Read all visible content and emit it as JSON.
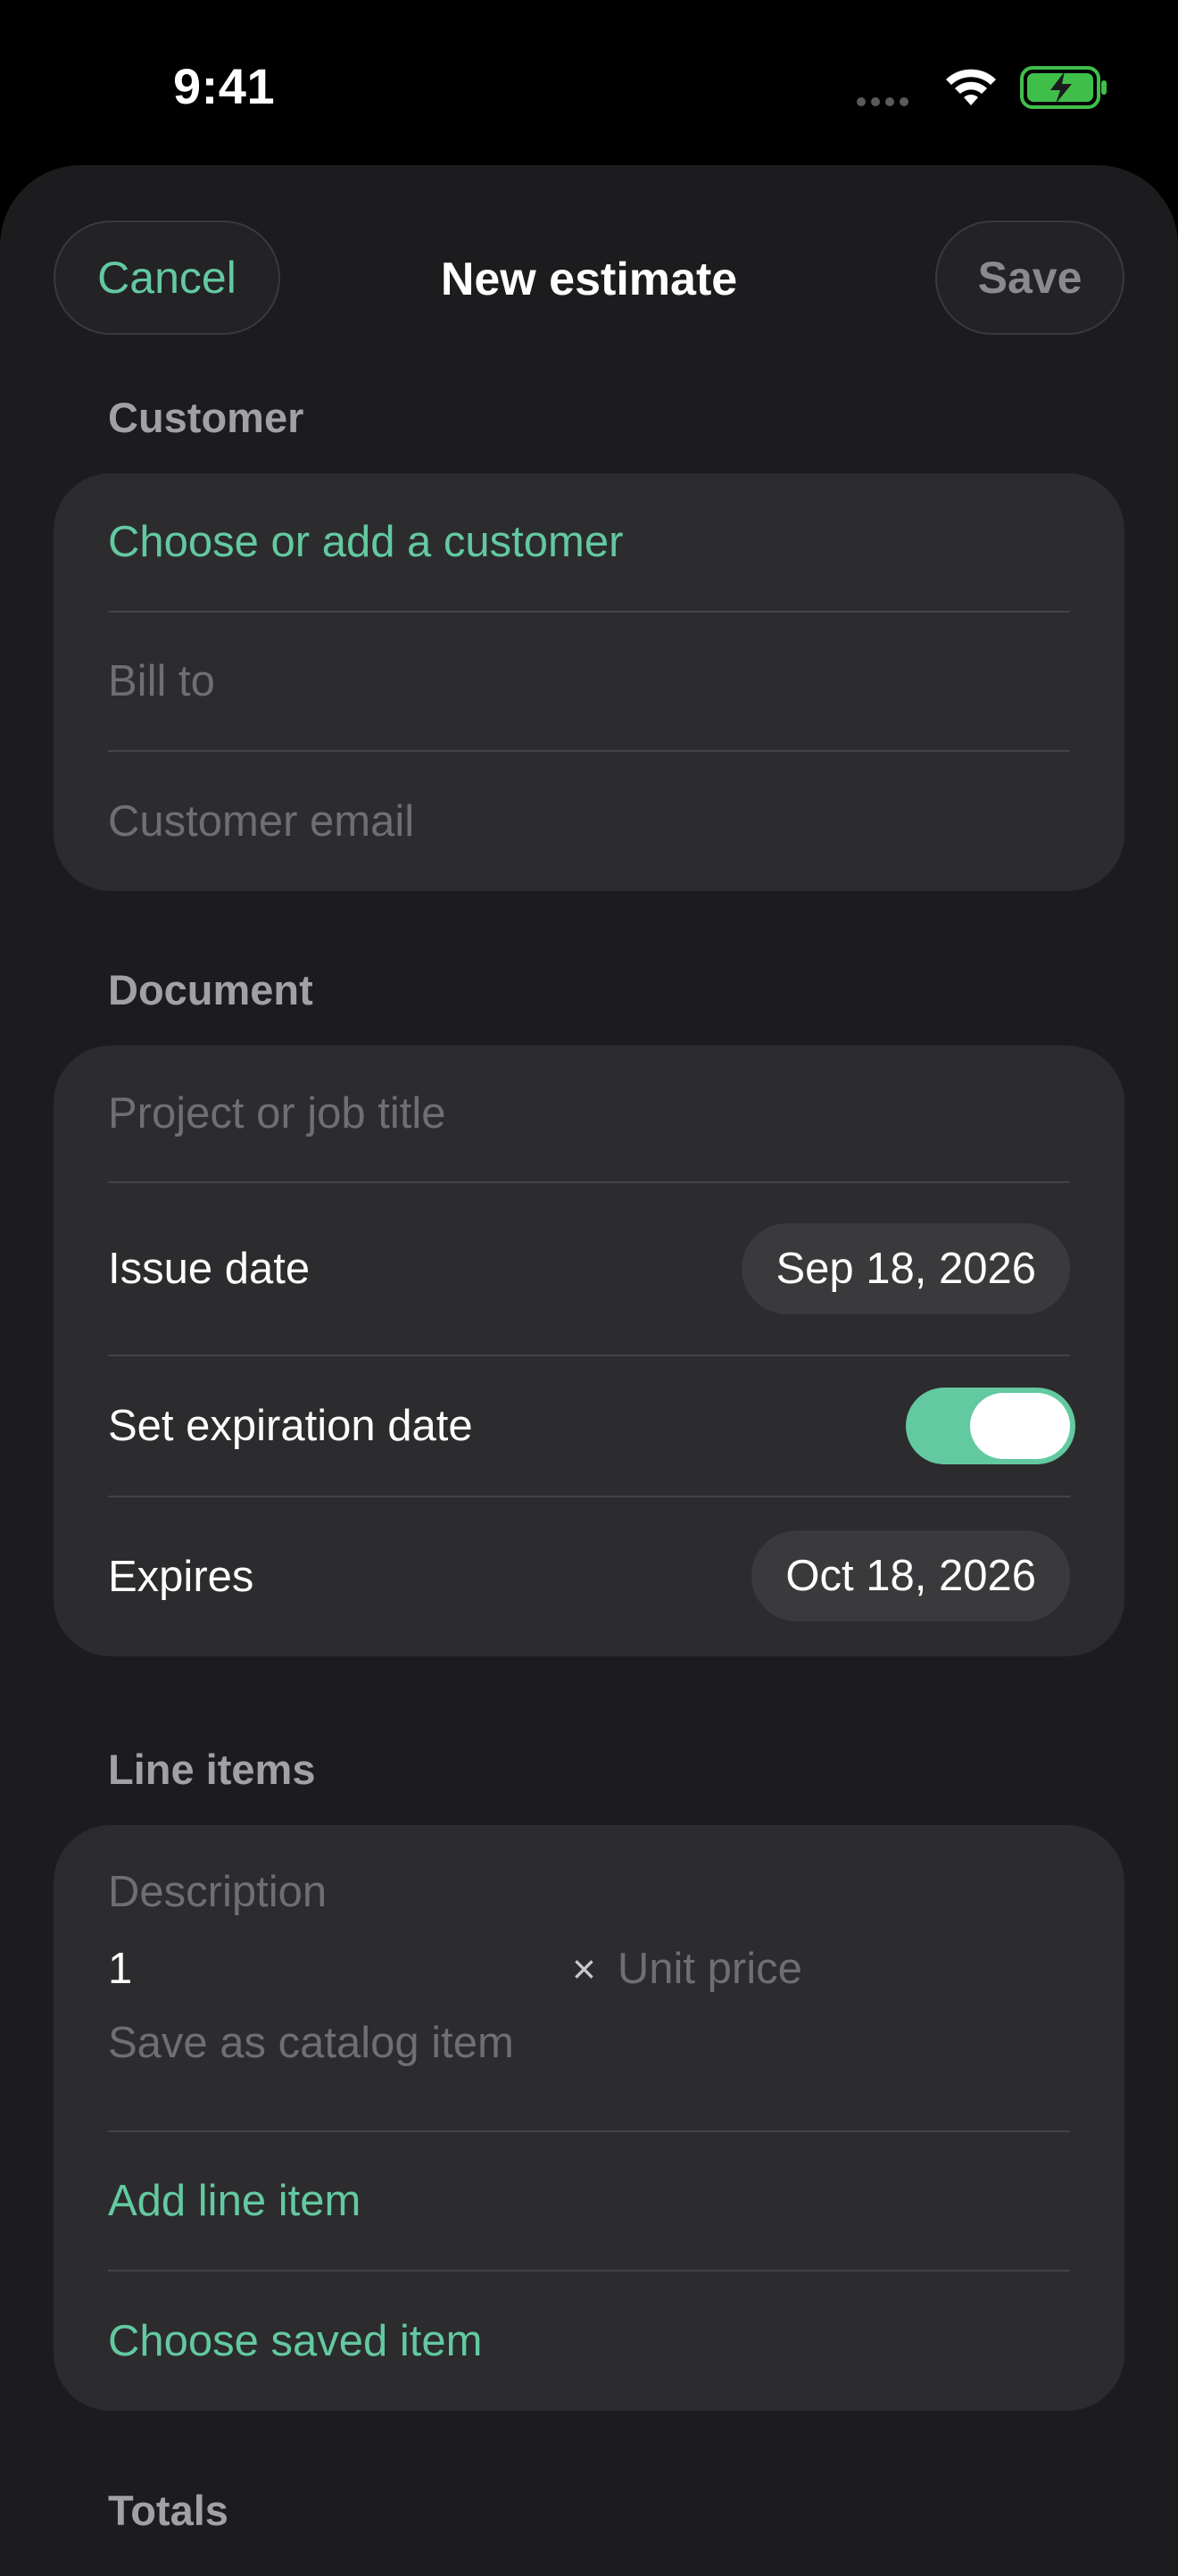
{
  "status_bar": {
    "time": "9:41",
    "icons": [
      "cellular-signal-icon",
      "wifi-icon",
      "battery-charging-icon"
    ]
  },
  "nav": {
    "cancel_label": "Cancel",
    "title": "New estimate",
    "save_label": "Save"
  },
  "customer": {
    "section_label": "Customer",
    "choose_label": "Choose or add a customer",
    "bill_to_placeholder": "Bill to",
    "email_placeholder": "Customer email"
  },
  "document": {
    "section_label": "Document",
    "title_placeholder": "Project or job title",
    "issue_date_label": "Issue date",
    "issue_date_value": "Sep 18, 2026",
    "expiration_label": "Set expiration date",
    "expiration_enabled": true,
    "expires_label": "Expires",
    "expires_value": "Oct 18, 2026"
  },
  "line_items": {
    "section_label": "Line items",
    "description_placeholder": "Description",
    "quantity": "1",
    "times_symbol": "×",
    "unit_price_placeholder": "Unit price",
    "save_catalog_label": "Save as catalog item",
    "add_label": "Add line item",
    "choose_saved_label": "Choose saved item"
  },
  "totals": {
    "section_label": "Totals"
  },
  "colors": {
    "accent": "#63c9a0",
    "background": "#1c1c1e",
    "card": "#2c2c2e",
    "placeholder": "#6e6e73"
  }
}
